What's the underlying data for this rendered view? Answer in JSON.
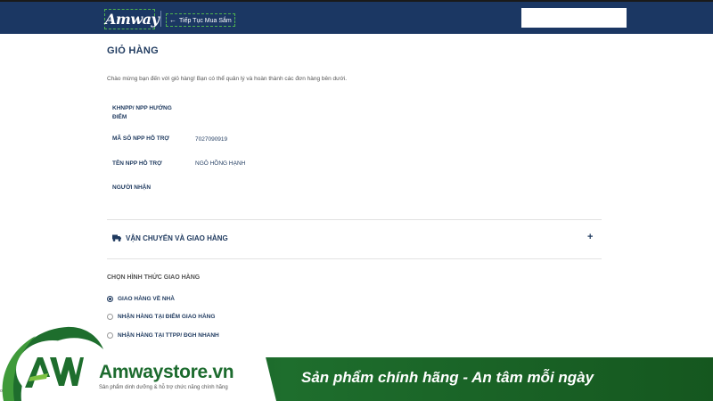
{
  "header": {
    "logo_text": "Amway",
    "continue_label": "Tiếp Tục Mua Sắm"
  },
  "cart": {
    "title": "GIỎ HÀNG",
    "welcome": "Chào mừng bạn đến với giỏ hàng! Bạn có thể quản lý và hoàn thành các đơn hàng bên dưới.",
    "fields": [
      {
        "label": "KHNPP/ NPP HƯỚNG ĐIỂM",
        "value": ""
      },
      {
        "label": "MÃ SỐ NPP HỖ TRỢ",
        "value": "7027090919"
      },
      {
        "label": "TÊN NPP HỖ TRỢ",
        "value": "NGÔ HỒNG HẠNH"
      },
      {
        "label": "NGƯỜI NHẬN",
        "value": ""
      }
    ]
  },
  "shipping": {
    "section_label": "VẬN CHUYỂN VÀ GIAO HÀNG",
    "expand_symbol": "+",
    "choose_label": "CHỌN HÌNH THỨC GIAO HÀNG",
    "options": [
      {
        "label": "GIAO HÀNG VỀ NHÀ",
        "selected": true
      },
      {
        "label": "NHẬN HÀNG TẠI ĐIỂM GIAO HÀNG",
        "selected": false
      },
      {
        "label": "NHẬN HÀNG TẠI TTPP/ ĐGH NHANH",
        "selected": false
      }
    ]
  },
  "banner": {
    "brand": "Amwaystore.vn",
    "tagline": "Sản phẩm dinh dưỡng & hỗ trợ chức năng chính hãng",
    "slogan": "Sản phẩm chính hãng - An tâm mỗi ngày",
    "edge_text": "o"
  },
  "colors": {
    "header_bg": "#1b3763",
    "text_primary": "#1f3a5f",
    "banner_green": "#1e6e2d"
  },
  "icons": [
    "truck-icon",
    "arrow-left-icon",
    "plus-icon",
    "aw-logo-icon"
  ]
}
